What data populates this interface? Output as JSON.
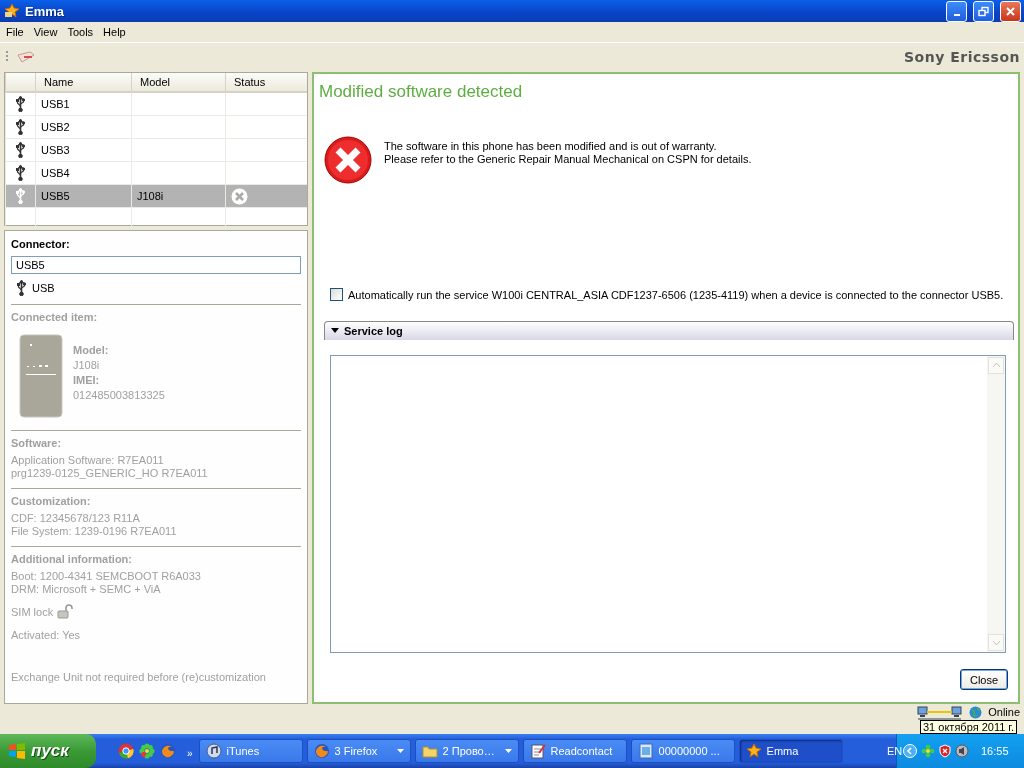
{
  "window": {
    "title": "Emma"
  },
  "menu": [
    {
      "label": "File"
    },
    {
      "label": "View"
    },
    {
      "label": "Tools"
    },
    {
      "label": "Help"
    }
  ],
  "toolbar": {
    "brand": "Sony Ericsson"
  },
  "connector_table": {
    "columns": [
      "Name",
      "Model",
      "Status"
    ],
    "rows": [
      {
        "name": "USB1",
        "error": false,
        "selected": false
      },
      {
        "name": "USB2",
        "error": false,
        "selected": false
      },
      {
        "name": "USB3",
        "error": false,
        "selected": false
      },
      {
        "name": "USB4",
        "error": false,
        "selected": false
      },
      {
        "name": "USB5",
        "model": "J108i",
        "error": true,
        "selected": true
      }
    ]
  },
  "connector": {
    "label": "Connector:",
    "value": "USB5",
    "type": "USB"
  },
  "connected_item": {
    "heading": "Connected item:",
    "model_label": "Model:",
    "model": "J108i",
    "imei_label": "IMEI:",
    "imei": "012485003813325"
  },
  "info_sections": [
    {
      "heading": "Software:",
      "lines": [
        "Application Software: R7EA011",
        "prg1239-0125_GENERIC_HO R7EA011"
      ]
    },
    {
      "heading": "Customization:",
      "lines": [
        "CDF: 12345678/123 R11A",
        "File System: 1239-0196 R7EA011"
      ]
    },
    {
      "heading": "Additional information:",
      "lines": [
        "Boot: 1200-4341 SEMCBOOT R6A033",
        "DRM: Microsoft + SEMC + ViA"
      ]
    }
  ],
  "sim_lock": {
    "label": "SIM lock",
    "locked": false
  },
  "activated": "Activated: Yes",
  "exchange_note": "Exchange Unit not required before (re)customization",
  "message": {
    "title": "Modified software detected",
    "lines": [
      "The software in this phone has been modified and is out of warranty.",
      "Please refer to the Generic Repair Manual Mechanical on CSPN for details."
    ]
  },
  "auto_run": {
    "label": "Automatically run the service W100i CENTRAL_ASIA CDF1237-6506 (1235-4119) when a device is connected to the connector USB5.",
    "checked": false
  },
  "service_log": {
    "label": "Service log",
    "expanded": true
  },
  "close_button": "Close",
  "status_bar": {
    "status": "Online"
  },
  "taskbar": {
    "start": "пуск",
    "more": "»",
    "tasks": [
      {
        "label": "iTunes",
        "kind": "music",
        "grouped": false,
        "selected": false
      },
      {
        "label": "3 Firefox",
        "kind": "browser",
        "grouped": true,
        "selected": false
      },
      {
        "label": "2 Прово…",
        "kind": "folder",
        "grouped": true,
        "selected": false
      },
      {
        "label": "Readcontact",
        "kind": "notepad",
        "grouped": false,
        "selected": false
      },
      {
        "label": "00000000 ...",
        "kind": "document",
        "grouped": false,
        "selected": false
      },
      {
        "label": "Emma",
        "kind": "app",
        "grouped": false,
        "selected": true
      }
    ],
    "language": "EN",
    "clock": "16:55",
    "tooltip": "31 октября 2011 г."
  }
}
